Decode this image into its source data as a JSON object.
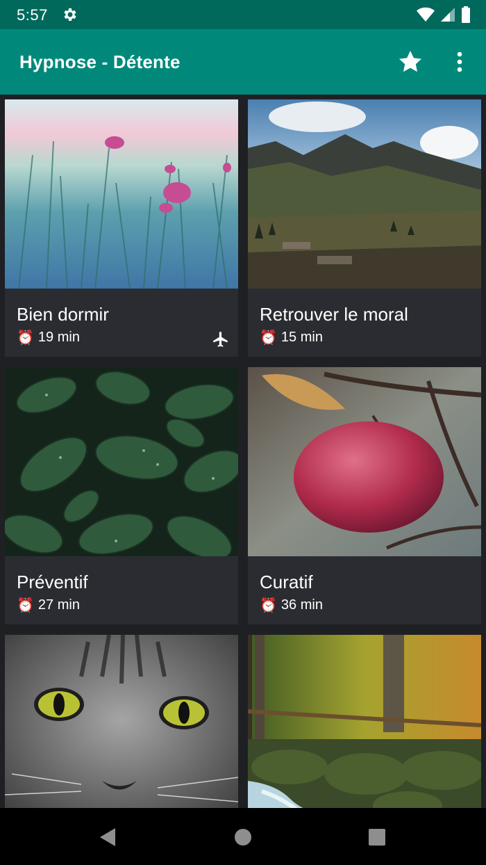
{
  "status_bar": {
    "time": "5:57",
    "icons": [
      "gear-icon",
      "wifi-icon",
      "signal-icon",
      "battery-icon"
    ]
  },
  "app_bar": {
    "title": "Hypnose - Détente",
    "actions": [
      "star-icon",
      "more-vert-icon"
    ]
  },
  "cards": [
    {
      "title": "Bien dormir",
      "duration": "19 min",
      "badge_icon": "airplane-icon"
    },
    {
      "title": "Retrouver le moral",
      "duration": "15 min"
    },
    {
      "title": "Préventif",
      "duration": "27 min"
    },
    {
      "title": "Curatif",
      "duration": "36 min"
    },
    {
      "title": "",
      "duration": ""
    },
    {
      "title": "",
      "duration": ""
    }
  ],
  "nav_bar": {
    "buttons": [
      "back-icon",
      "home-icon",
      "recents-icon"
    ]
  },
  "colors": {
    "status_bar": "#00695c",
    "app_bar": "#00897b",
    "background": "#1f2023",
    "card": "#2b2c31"
  }
}
